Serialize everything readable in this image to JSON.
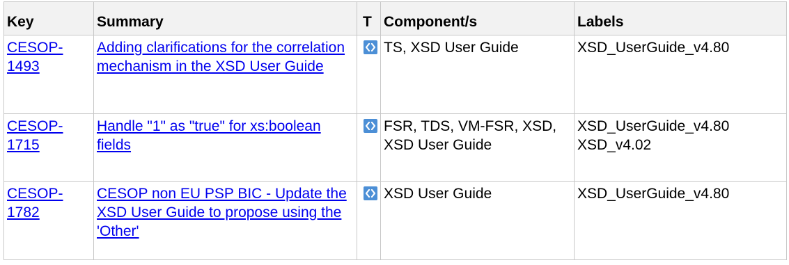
{
  "table": {
    "headers": [
      "Key",
      "Summary",
      "T",
      "Component/s",
      "Labels"
    ],
    "rows": [
      {
        "key_line1": "CESOP-",
        "key_line2": "1493",
        "summary": "Adding clarifications for the correlation mechanism in the XSD User Guide",
        "type_icon": "improvement-icon",
        "components": "TS, XSD User Guide",
        "labels": [
          "XSD_UserGuide_v4.80"
        ]
      },
      {
        "key_line1": "CESOP-",
        "key_line2": "1715",
        "summary": "Handle \"1\" as \"true\" for xs:boolean fields",
        "type_icon": "improvement-icon",
        "components": "FSR, TDS, VM-FSR, XSD, XSD User Guide",
        "labels": [
          "XSD_UserGuide_v4.80",
          "XSD_v4.02"
        ]
      },
      {
        "key_line1": "CESOP-",
        "key_line2": "1782",
        "summary": "CESOP non EU PSP BIC - Update the XSD User Guide to propose using the 'Other'",
        "type_icon": "improvement-icon",
        "components": "XSD User Guide",
        "labels": [
          "XSD_UserGuide_v4.80"
        ]
      }
    ]
  },
  "colors": {
    "link": "#0000ee",
    "header_bg": "#f2f2f2",
    "border": "#c7c7c7",
    "icon_bg": "#4c8fd6"
  }
}
